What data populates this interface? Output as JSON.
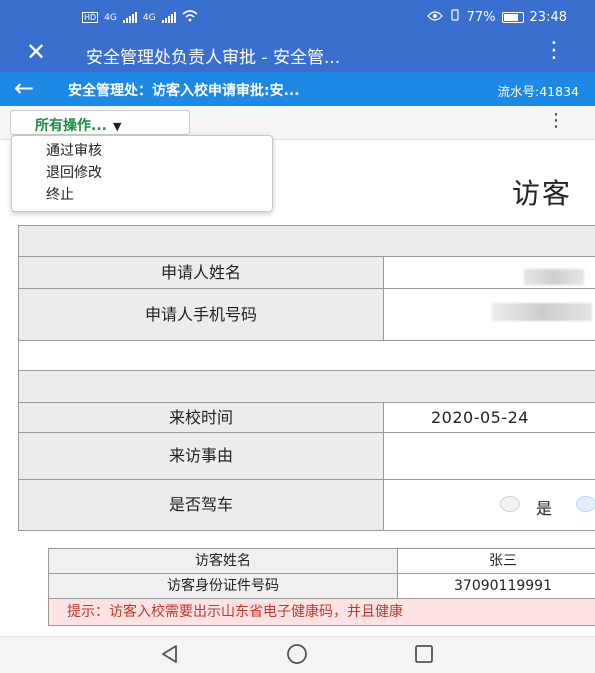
{
  "status": {
    "hd_labels": [
      "HD",
      "HD"
    ],
    "network": [
      "4G",
      "4G"
    ],
    "battery": "77%",
    "time": "23:48"
  },
  "titlebar": {
    "title": "安全管理处负责人审批 - 安全管..."
  },
  "subbar": {
    "title": "安全管理处：访客入校申请审批:安...",
    "serial": "流水号:41834"
  },
  "toolbar": {
    "ops_label": "所有操作..."
  },
  "dropdown": {
    "items": [
      "通过审核",
      "退回修改",
      "终止"
    ]
  },
  "form": {
    "title": "访客",
    "rows": {
      "applicant_name_label": "申请人姓名",
      "applicant_phone_label": "申请人手机号码",
      "visit_time_label": "来校时间",
      "visit_time_value": "2020-05-24",
      "visit_reason_label": "来访事由",
      "driving_label": "是否驾车",
      "driving_yes": "是"
    }
  },
  "visitor_table": {
    "name_label": "访客姓名",
    "name_value": "张三",
    "id_label": "访客身份证件号码",
    "id_value": "37090119991",
    "hint": "提示：访客入校需要出示山东省电子健康码，并且健康"
  },
  "icons": {
    "close": "close-icon",
    "more": "more-vertical-icon",
    "back": "arrow-left-icon",
    "caret": "caret-down-icon",
    "nav_back": "triangle-back-icon",
    "nav_home": "circle-home-icon",
    "nav_recent": "square-recent-icon"
  },
  "colors": {
    "titlebar": "#3a6fd0",
    "subbar": "#1e88e5",
    "ops_text": "#1c8c3e",
    "hint_bg": "#fde3e3",
    "hint_text": "#c0392b"
  }
}
